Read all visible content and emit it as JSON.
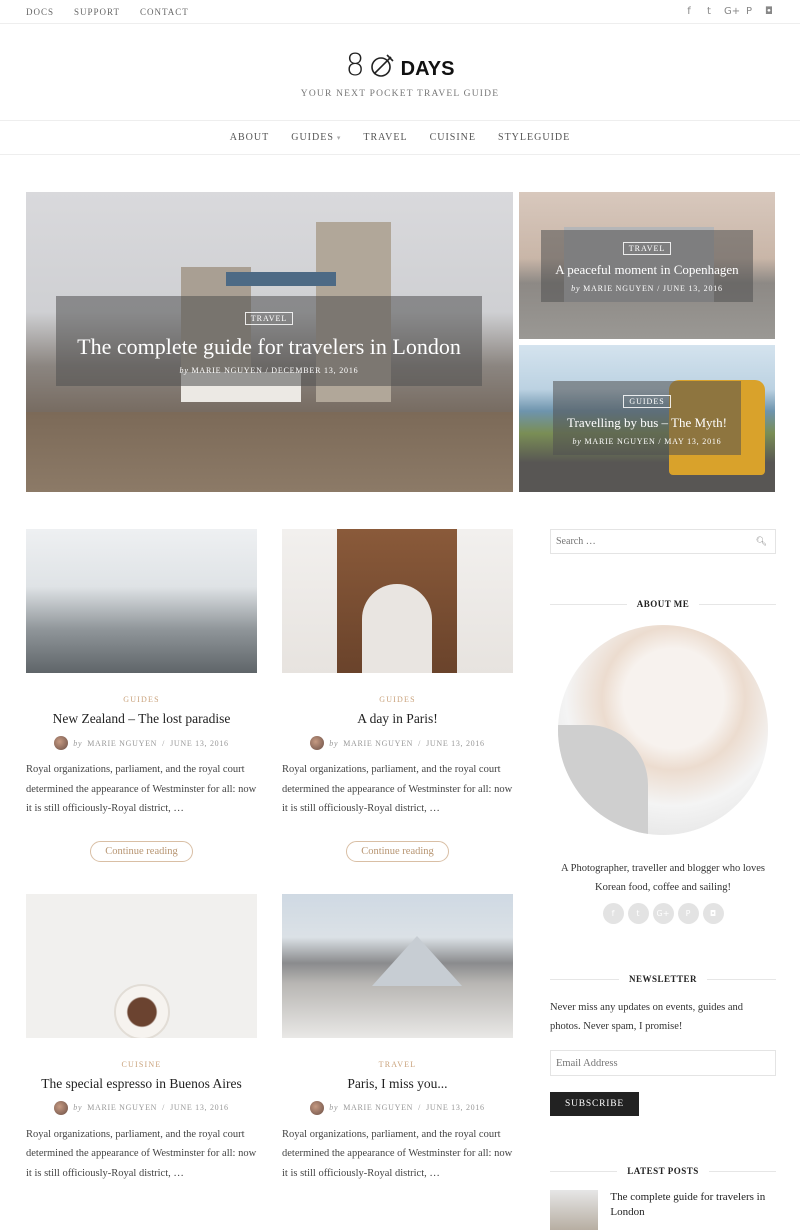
{
  "topbar": {
    "links": [
      "DOCS",
      "SUPPORT",
      "CONTACT"
    ],
    "social_icons": [
      {
        "name": "facebook-icon",
        "glyph": "f"
      },
      {
        "name": "twitter-icon",
        "glyph": "t"
      },
      {
        "name": "google-plus-icon",
        "glyph": "G+"
      },
      {
        "name": "pinterest-icon",
        "glyph": "P"
      },
      {
        "name": "instagram-icon",
        "glyph": "◘"
      }
    ]
  },
  "brand": {
    "logo_number": "8",
    "logo_word": "DAYS",
    "tagline": "YOUR NEXT POCKET TRAVEL GUIDE"
  },
  "nav": {
    "items": [
      "ABOUT",
      "GUIDES",
      "TRAVEL",
      "CUISINE",
      "STYLEGUIDE"
    ],
    "caret": "▾"
  },
  "featured": {
    "main": {
      "category": "TRAVEL",
      "title": "The complete guide for travelers in London",
      "by": "by",
      "author": "MARIE NGUYEN",
      "date": "DECEMBER 13, 2016"
    },
    "side": [
      {
        "category": "TRAVEL",
        "title": "A peaceful moment in Copenhagen",
        "by": "by",
        "author": "MARIE NGUYEN",
        "date": "JUNE 13, 2016"
      },
      {
        "category": "GUIDES",
        "title": "Travelling by bus – The Myth!",
        "by": "by",
        "author": "MARIE NGUYEN",
        "date": "MAY 13, 2016"
      }
    ]
  },
  "posts": [
    {
      "category": "GUIDES",
      "title": "New Zealand – The lost paradise",
      "by": "by",
      "author": "MARIE NGUYEN",
      "date": "JUNE 13, 2016",
      "excerpt": "Royal organizations, parliament, and the royal court determined the appearance of Westminster for all: now it is still officiously-Royal district, …",
      "button": "Continue reading"
    },
    {
      "category": "GUIDES",
      "title": "A day in Paris!",
      "by": "by",
      "author": "MARIE NGUYEN",
      "date": "JUNE 13, 2016",
      "excerpt": "Royal organizations, parliament, and the royal court determined the appearance of Westminster for all: now it is still officiously-Royal district, …",
      "button": "Continue reading"
    },
    {
      "category": "CUISINE",
      "title": "The special espresso in Buenos Aires",
      "by": "by",
      "author": "MARIE NGUYEN",
      "date": "JUNE 13, 2016",
      "excerpt": "Royal organizations, parliament, and the royal court determined the appearance of Westminster for all: now it is still officiously-Royal district, …"
    },
    {
      "category": "TRAVEL",
      "title": "Paris, I miss you...",
      "by": "by",
      "author": "MARIE NGUYEN",
      "date": "JUNE 13, 2016",
      "excerpt": "Royal organizations, parliament, and the royal court determined the appearance of Westminster for all: now it is still officiously-Royal district, …"
    }
  ],
  "sidebar": {
    "search_placeholder": "Search …",
    "about_title": "ABOUT ME",
    "about_text": "A Photographer, traveller and blogger who loves Korean food, coffee and sailing!",
    "newsletter_title": "NEWSLETTER",
    "newsletter_text": "Never miss any updates on events, guides and photos. Never spam, I promise!",
    "email_placeholder": "Email Address",
    "subscribe_label": "SUBSCRIBE",
    "latest_title": "LATEST POSTS",
    "latest_posts": [
      "The complete guide for travelers in London"
    ]
  },
  "colors": {
    "accent": "#c9a27b",
    "dark_button": "#222222"
  }
}
